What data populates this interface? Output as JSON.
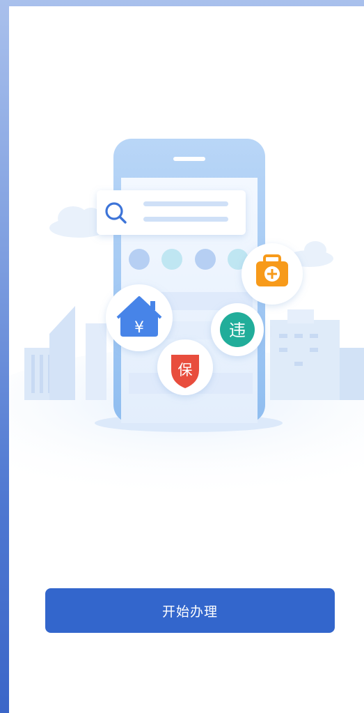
{
  "illustration": {
    "house_glyph": "¥",
    "violation_glyph": "违",
    "insurance_glyph": "保",
    "icons": [
      "search-icon",
      "house-yuan-icon",
      "violation-icon",
      "insurance-shield-icon",
      "medical-kit-icon"
    ],
    "colors": {
      "phone": "#a9ccf4",
      "screen": "#eef5fe",
      "house": "#4784e8",
      "violation": "#21ad9a",
      "insurance": "#e84d3d",
      "medical": "#f79a1a"
    }
  },
  "actions": {
    "start_label": "开始办理",
    "button_color": "#3366cc"
  }
}
